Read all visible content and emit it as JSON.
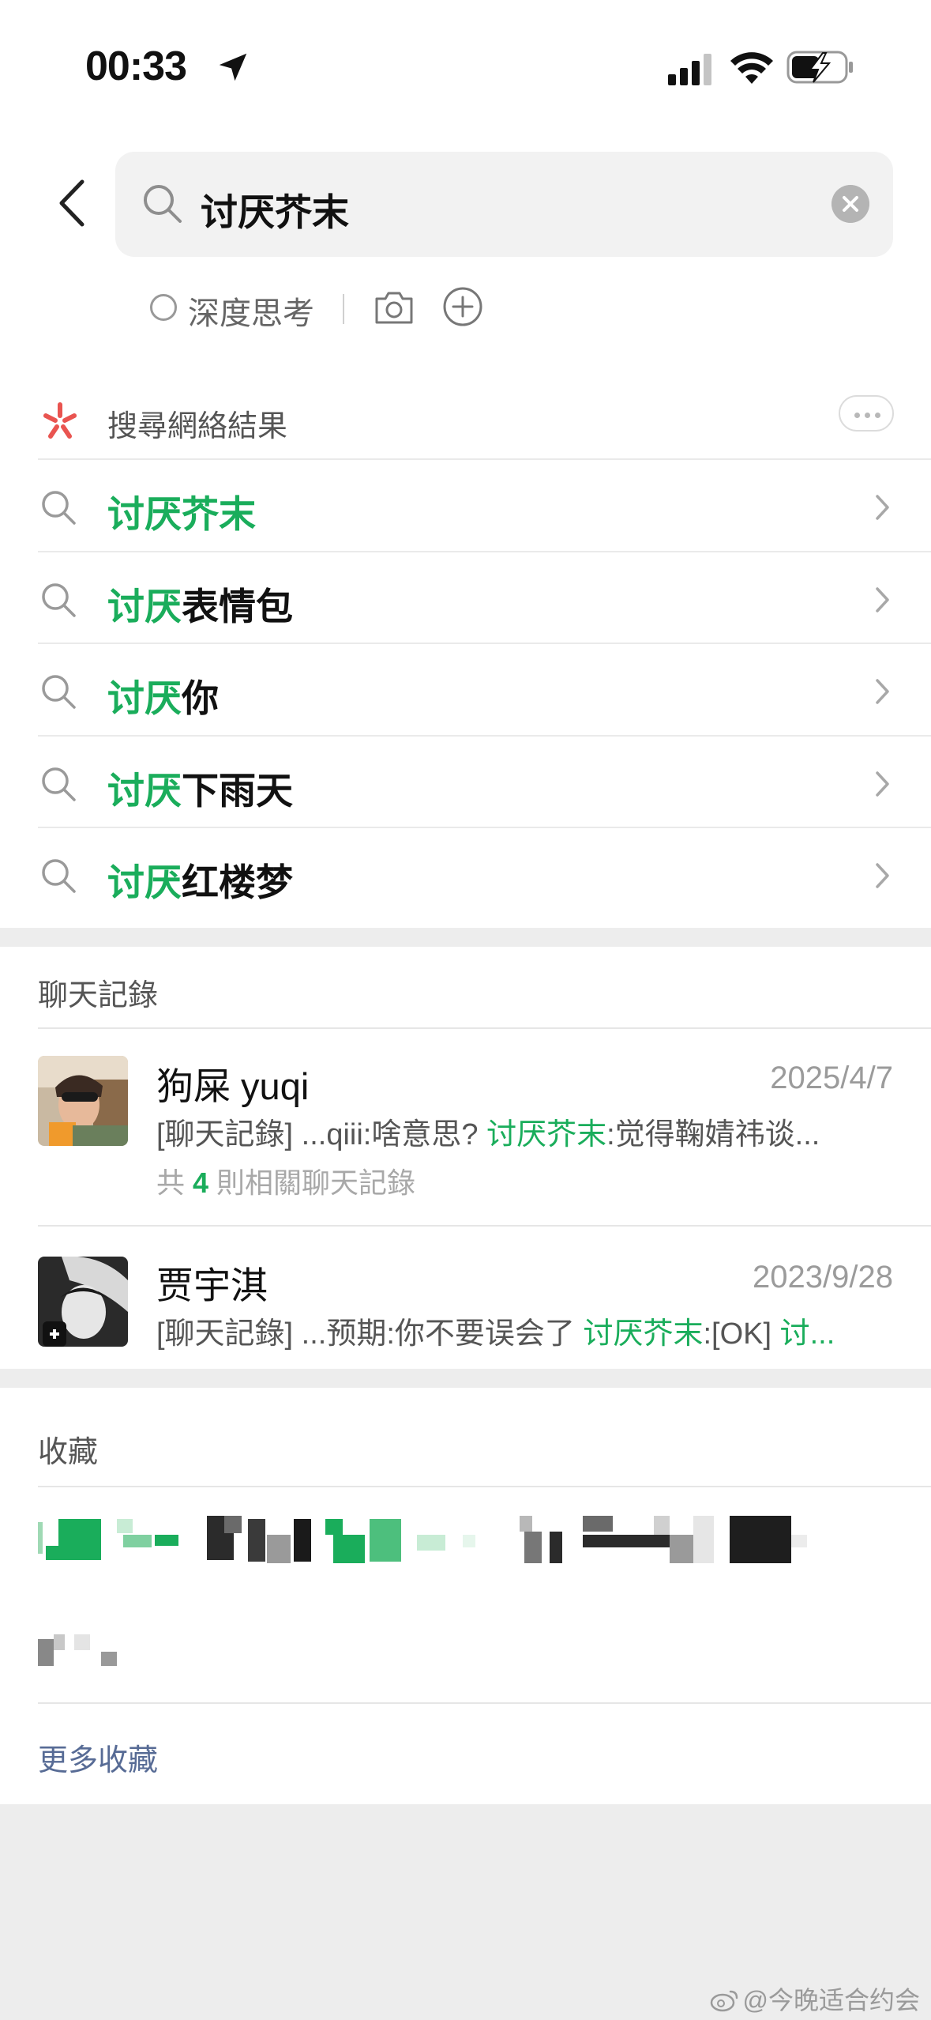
{
  "status_bar": {
    "time": "00:33"
  },
  "search": {
    "query": "讨厌芥末"
  },
  "options": {
    "deep_think_label": "深度思考"
  },
  "web_results": {
    "title": "搜尋網絡結果",
    "suggestions": [
      {
        "highlight": "讨厌芥末",
        "rest": ""
      },
      {
        "highlight": "讨厌",
        "rest": "表情包"
      },
      {
        "highlight": "讨厌",
        "rest": "你"
      },
      {
        "highlight": "讨厌",
        "rest": "下雨天"
      },
      {
        "highlight": "讨厌",
        "rest": "红楼梦"
      }
    ]
  },
  "chat_records": {
    "title": "聊天記錄",
    "items": [
      {
        "name": "狗屎 yuqi",
        "date": "2025/4/7",
        "snippet_pre": "[聊天記錄] ...qiii:啥意思?  ",
        "snippet_hl": "讨厌芥末",
        "snippet_post": ":觉得鞠婧祎谈...",
        "count_pre": "共 ",
        "count_num": "4",
        "count_post": " 則相關聊天記錄"
      },
      {
        "name": "贾宇淇",
        "date": "2023/9/28",
        "snippet_pre": "[聊天記錄] ...预期:你不要误会了 ",
        "snippet_hl": "讨厌芥末",
        "snippet_post": ":[OK] ",
        "snippet_hl2": "讨..."
      }
    ]
  },
  "favorites": {
    "title": "收藏",
    "more_label": "更多收藏"
  },
  "watermark": "@今晚适合约会",
  "colors": {
    "highlight": "#1aad5b",
    "link": "#576b95",
    "background": "#ededed"
  }
}
